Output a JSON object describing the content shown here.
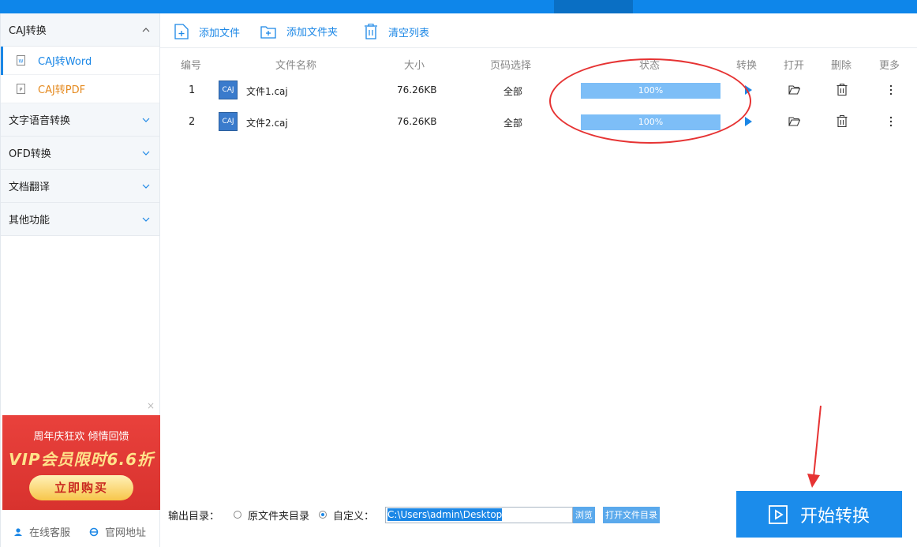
{
  "sidebar": {
    "categories": [
      {
        "label": "CAJ转换",
        "expanded": true
      },
      {
        "label": "文字语音转换"
      },
      {
        "label": "OFD转换"
      },
      {
        "label": "文档翻译"
      },
      {
        "label": "其他功能"
      }
    ],
    "sub_items": [
      {
        "label": "CAJ转Word",
        "active": true,
        "icon_letter": "W"
      },
      {
        "label": "CAJ转PDF",
        "active": false,
        "icon_letter": "P"
      }
    ],
    "ad": {
      "line1": "周年庆狂欢 倾情回馈",
      "line2": "VIP会员限时6.6折",
      "button": "立即购买",
      "close": "×"
    },
    "footer": {
      "service": "在线客服",
      "website": "官网地址"
    }
  },
  "toolbar": {
    "add_file": "添加文件",
    "add_folder": "添加文件夹",
    "clear_list": "清空列表"
  },
  "table": {
    "headers": {
      "index": "编号",
      "name": "文件名称",
      "size": "大小",
      "pages": "页码选择",
      "status": "状态",
      "convert": "转换",
      "open": "打开",
      "delete": "删除",
      "more": "更多"
    },
    "rows": [
      {
        "index": "1",
        "badge": "CAJ",
        "name": "文件1.caj",
        "size": "76.26KB",
        "pages": "全部",
        "status": "100%",
        "progress": 1.0
      },
      {
        "index": "2",
        "badge": "CAJ",
        "name": "文件2.caj",
        "size": "76.26KB",
        "pages": "全部",
        "status": "100%",
        "progress": 1.0
      }
    ]
  },
  "output": {
    "label": "输出目录：",
    "option_original": "原文件夹目录",
    "option_custom": "自定义：",
    "path": "C:\\Users\\admin\\Desktop",
    "browse": "浏览",
    "open_dir": "打开文件目录"
  },
  "start_button": "开始转换",
  "colors": {
    "accent": "#1b87e6",
    "progress": "#7dbef7",
    "annotation": "#e63333"
  }
}
